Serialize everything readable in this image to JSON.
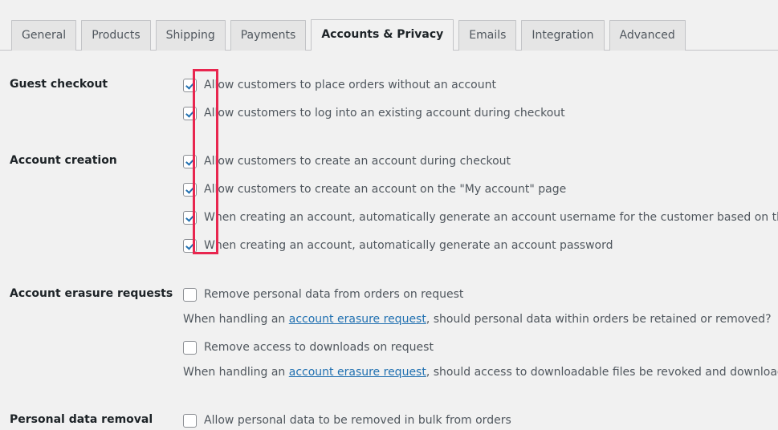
{
  "tabs": [
    {
      "label": "General",
      "active": false
    },
    {
      "label": "Products",
      "active": false
    },
    {
      "label": "Shipping",
      "active": false
    },
    {
      "label": "Payments",
      "active": false
    },
    {
      "label": "Accounts & Privacy",
      "active": true
    },
    {
      "label": "Emails",
      "active": false
    },
    {
      "label": "Integration",
      "active": false
    },
    {
      "label": "Advanced",
      "active": false
    }
  ],
  "sections": {
    "guest_checkout": {
      "label": "Guest checkout",
      "options": [
        {
          "label": "Allow customers to place orders without an account",
          "checked": true
        },
        {
          "label": "Allow customers to log into an existing account during checkout",
          "checked": true
        }
      ]
    },
    "account_creation": {
      "label": "Account creation",
      "options": [
        {
          "label": "Allow customers to create an account during checkout",
          "checked": true
        },
        {
          "label": "Allow customers to create an account on the \"My account\" page",
          "checked": true
        },
        {
          "label": "When creating an account, automatically generate an account username for the customer based on their name, su",
          "checked": true
        },
        {
          "label": "When creating an account, automatically generate an account password",
          "checked": true
        }
      ]
    },
    "account_erasure_requests": {
      "label": "Account erasure requests",
      "option_orders": {
        "label": "Remove personal data from orders on request",
        "checked": false
      },
      "desc_orders_pre": "When handling an ",
      "desc_orders_link": "account erasure request",
      "desc_orders_post": ", should personal data within orders be retained or removed?",
      "option_downloads": {
        "label": "Remove access to downloads on request",
        "checked": false
      },
      "desc_downloads_pre": "When handling an ",
      "desc_downloads_link": "account erasure request",
      "desc_downloads_post": ", should access to downloadable files be revoked and download logs clear"
    },
    "personal_data_removal": {
      "label": "Personal data removal",
      "options": [
        {
          "label": "Allow personal data to be removed in bulk from orders",
          "checked": false
        }
      ]
    }
  },
  "annotation": {
    "highlight_color": "#e8264f",
    "target": "checkbox-column-guest-and-account-creation"
  }
}
